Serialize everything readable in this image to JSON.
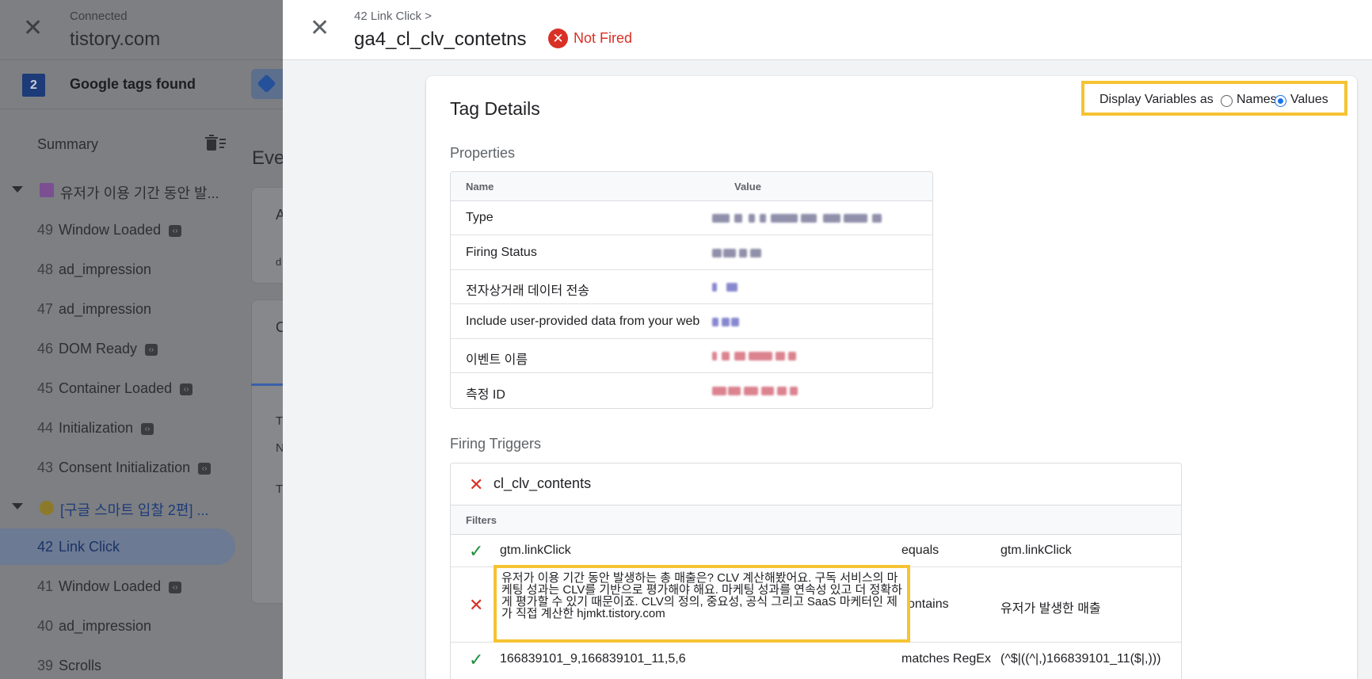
{
  "left_panel": {
    "connected_label": "Connected",
    "site": "tistory.com",
    "tag_count": "2",
    "tags_found": "Google tags found",
    "summary": "Summary",
    "events": [
      {
        "kind": "group",
        "name": "유저가 이용 기간 동안 발...",
        "color": "#7b4f91"
      },
      {
        "kind": "event",
        "num": "49",
        "name": "Window Loaded",
        "badge": true
      },
      {
        "kind": "event",
        "num": "48",
        "name": "ad_impression",
        "badge": false
      },
      {
        "kind": "event",
        "num": "47",
        "name": "ad_impression",
        "badge": false
      },
      {
        "kind": "event",
        "num": "46",
        "name": "DOM Ready",
        "badge": true
      },
      {
        "kind": "event",
        "num": "45",
        "name": "Container Loaded",
        "badge": true
      },
      {
        "kind": "event",
        "num": "44",
        "name": "Initialization",
        "badge": true
      },
      {
        "kind": "event",
        "num": "43",
        "name": "Consent Initialization",
        "badge": true
      },
      {
        "kind": "group",
        "name": "[구글 스마트 입찰 2편] ...",
        "color": "#8c7a2a"
      },
      {
        "kind": "event",
        "num": "42",
        "name": "Link Click",
        "badge": false,
        "selected": true
      },
      {
        "kind": "event",
        "num": "41",
        "name": "Window Loaded",
        "badge": true
      },
      {
        "kind": "event",
        "num": "40",
        "name": "ad_impression",
        "badge": false
      },
      {
        "kind": "event",
        "num": "39",
        "name": "Scrolls",
        "badge": false
      }
    ],
    "partial_heading": "Eve",
    "partial_card_texts": [
      "A",
      "d",
      "C",
      "T",
      "N",
      "T"
    ]
  },
  "header": {
    "breadcrumb": "42 Link Click >",
    "tag_name": "ga4_cl_clv_contetns",
    "status": "Not Fired",
    "status_color": "#d93025"
  },
  "tag_details": {
    "title": "Tag Details",
    "display_label": "Display Variables as",
    "option_names": "Names",
    "option_values": "Values",
    "selected_option": "Values",
    "properties_label": "Properties",
    "col_name": "Name",
    "col_value": "Value",
    "properties": [
      {
        "name": "Type",
        "value_color": "#6b6b90"
      },
      {
        "name": "Firing Status",
        "value_color": "#6b6b90"
      },
      {
        "name": "전자상거래 데이터 전송",
        "value_color": "#6060c0"
      },
      {
        "name": "Include user-provided data from your web",
        "value_color": "#6060c0"
      },
      {
        "name": "이벤트 이름",
        "value_color": "#d05a6a"
      },
      {
        "name": "측정 ID",
        "value_color": "#d05a6a"
      }
    ]
  },
  "firing_triggers": {
    "label": "Firing Triggers",
    "trigger_name": "cl_clv_contents",
    "filters_label": "Filters",
    "filters": [
      {
        "status": "pass",
        "variable": "gtm.linkClick",
        "operator": "equals",
        "value": "gtm.linkClick"
      },
      {
        "status": "fail",
        "variable": "유저가 이용 기간 동안 발생하는 총 매출은? CLV 계산해봤어요. 구독 서비스의 마케팅 성과는 CLV를 기반으로 평가해야 해요. 마케팅 성과를 연속성 있고 더 정확하게 평가할 수 있기 때문이죠. CLV의 정의, 중요성, 공식 그리고 SaaS 마케터인 제가 직접 계산한 hjmkt.tistory.com",
        "operator": "contains",
        "value": "유저가 발생한 매출"
      },
      {
        "status": "pass",
        "variable": "166839101_9,166839101_11,5,6",
        "operator": "matches RegEx",
        "value": "(^$|((^|,)166839101_11($|,)))"
      }
    ]
  },
  "colors": {
    "highlight": "#f6c333",
    "pass": "#1e8e3e",
    "fail": "#d93025",
    "accent": "#1a73e8"
  }
}
